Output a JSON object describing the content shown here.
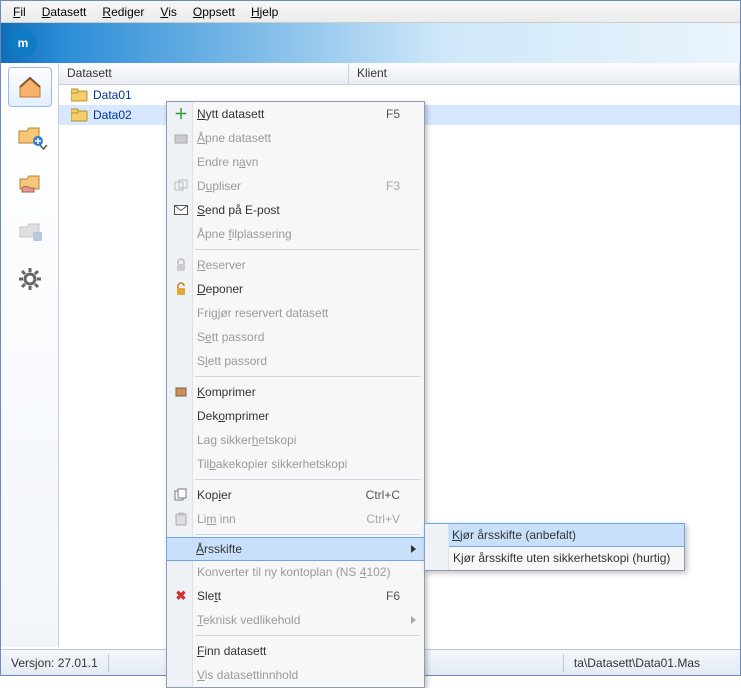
{
  "menubar": {
    "file": {
      "pre": "",
      "u": "F",
      "post": "il"
    },
    "datasett": {
      "pre": "",
      "u": "D",
      "post": "atasett"
    },
    "rediger": {
      "pre": "",
      "u": "R",
      "post": "ediger"
    },
    "vis": {
      "pre": "",
      "u": "V",
      "post": "is"
    },
    "oppsett": {
      "pre": "",
      "u": "O",
      "post": "ppsett"
    },
    "hjelp": {
      "pre": "",
      "u": "H",
      "post": "jelp"
    }
  },
  "logo_letter": "m",
  "header": {
    "col1": "Datasett",
    "col2": "Klient"
  },
  "rows": [
    {
      "label": "Data01"
    },
    {
      "label": "Data02"
    }
  ],
  "context_menu": {
    "nytt_datasett": {
      "pre": "",
      "u": "N",
      "post": "ytt datasett",
      "shortcut": "F5"
    },
    "apne_datasett": {
      "pre": "",
      "u": "Å",
      "post": "pne datasett"
    },
    "endre_navn": {
      "pre": "Endre n",
      "u": "a",
      "post": "vn"
    },
    "dupliser": {
      "pre": "D",
      "u": "u",
      "post": "pliser",
      "shortcut": "F3"
    },
    "send_epost": {
      "pre": "",
      "u": "S",
      "post": "end på E-post"
    },
    "apne_filpl": {
      "pre": "Åpne ",
      "u": "f",
      "post": "ilplassering"
    },
    "reserver": {
      "pre": "",
      "u": "R",
      "post": "eserver"
    },
    "deponer": {
      "pre": "",
      "u": "D",
      "post": "eponer"
    },
    "frigjor": {
      "pre": "Fri",
      "u": "g",
      "post": "jør reservert datasett"
    },
    "sett_passord": {
      "pre": "S",
      "u": "e",
      "post": "tt passord"
    },
    "slett_passord": {
      "pre": "S",
      "u": "l",
      "post": "ett passord"
    },
    "komprimer": {
      "pre": "",
      "u": "K",
      "post": "omprimer"
    },
    "dekomprimer": {
      "pre": "Dek",
      "u": "o",
      "post": "mprimer"
    },
    "lag_sikker": {
      "pre": "Lag sikker",
      "u": "h",
      "post": "etskopi"
    },
    "tilbake": {
      "pre": "Til",
      "u": "b",
      "post": "akekopier sikkerhetskopi"
    },
    "kopier": {
      "pre": "Kop",
      "u": "i",
      "post": "er",
      "shortcut": "Ctrl+C"
    },
    "lim_inn": {
      "pre": "Li",
      "u": "m",
      "post": " inn",
      "shortcut": "Ctrl+V"
    },
    "arsskifte": {
      "pre": "",
      "u": "Å",
      "post": "rsskifte"
    },
    "konverter": {
      "pre": "Konverter til ny kontoplan (NS ",
      "u": "4",
      "post": "102)"
    },
    "slett": {
      "pre": "Sle",
      "u": "t",
      "post": "t",
      "shortcut": "F6"
    },
    "teknisk": {
      "pre": "",
      "u": "T",
      "post": "eknisk vedlikehold"
    },
    "finn": {
      "pre": "",
      "u": "F",
      "post": "inn datasett"
    },
    "vis_innh": {
      "pre": "",
      "u": "V",
      "post": "is datasettinnhold"
    }
  },
  "submenu": {
    "anbefalt": {
      "pre": "",
      "u": "K",
      "post": "jør årsskifte (anbefalt)"
    },
    "hurtig": {
      "pre": "Kjør årsskifte uten sikkerhetskopi (hurtig)"
    }
  },
  "statusbar": {
    "version_label": "Versjon:",
    "version_value": "27.01.1",
    "path": "ta\\Datasett\\Data01.Mas"
  },
  "colors": {
    "accent": "#0e7bc5",
    "highlight": "#c9e0fb"
  }
}
